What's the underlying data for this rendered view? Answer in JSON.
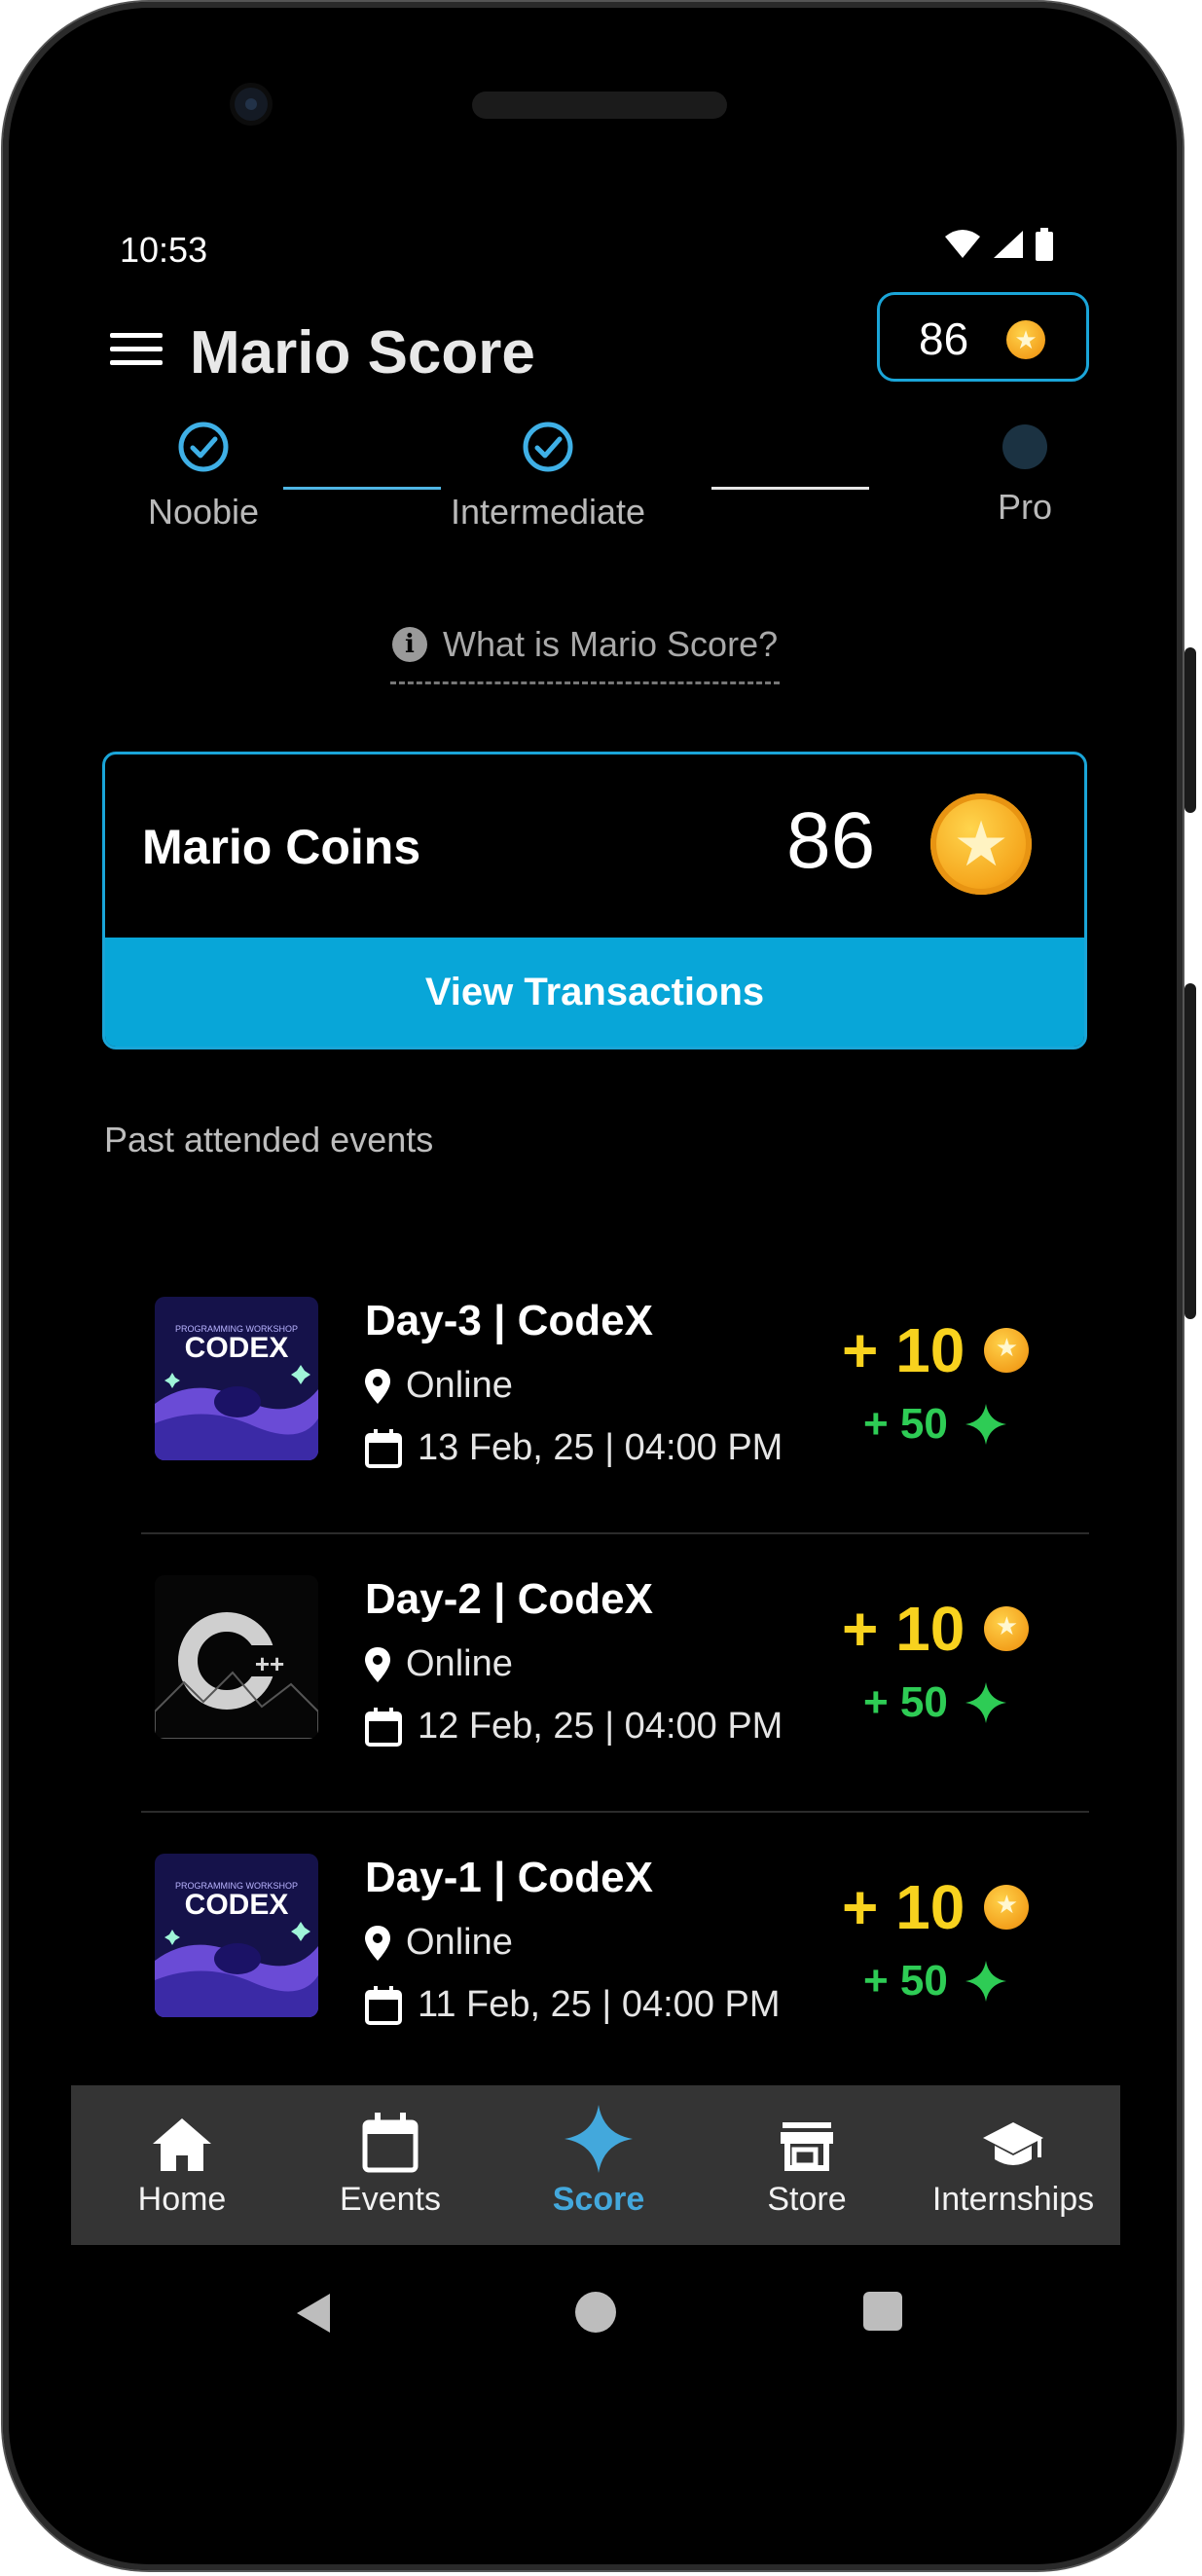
{
  "status_bar": {
    "time": "10:53"
  },
  "app_bar": {
    "title": "Mario Score",
    "coin_balance": "86"
  },
  "progress": {
    "steps": [
      {
        "label": "Noobie",
        "done": true
      },
      {
        "label": "Intermediate",
        "done": true
      },
      {
        "label": "Pro",
        "done": false
      }
    ]
  },
  "info_link": "What is Mario Score?",
  "coins_card": {
    "label": "Mario Coins",
    "value": "86",
    "button": "View Transactions"
  },
  "section_title": "Past attended events",
  "events": [
    {
      "title": "Day-3 | CodeX",
      "location": "Online",
      "datetime": "13 Feb, 25 | 04:00 PM",
      "coins": "+ 10",
      "xp": "+ 50",
      "thumb": "codex"
    },
    {
      "title": "Day-2 | CodeX",
      "location": "Online",
      "datetime": "12 Feb, 25 | 04:00 PM",
      "coins": "+ 10",
      "xp": "+ 50",
      "thumb": "cpp"
    },
    {
      "title": "Day-1 | CodeX",
      "location": "Online",
      "datetime": "11 Feb, 25 | 04:00 PM",
      "coins": "+ 10",
      "xp": "+ 50",
      "thumb": "codex"
    }
  ],
  "bottom_nav": {
    "items": [
      {
        "label": "Home",
        "icon": "home-icon"
      },
      {
        "label": "Events",
        "icon": "calendar-icon"
      },
      {
        "label": "Score",
        "icon": "sparkle-icon",
        "active": true
      },
      {
        "label": "Store",
        "icon": "store-icon"
      },
      {
        "label": "Internships",
        "icon": "graduation-cap-icon"
      }
    ]
  },
  "colors": {
    "accent": "#08a6d8",
    "coin_text": "#f8d21e",
    "xp_text": "#2ecc55",
    "nav_active": "#43a8dc",
    "background": "#000000"
  }
}
